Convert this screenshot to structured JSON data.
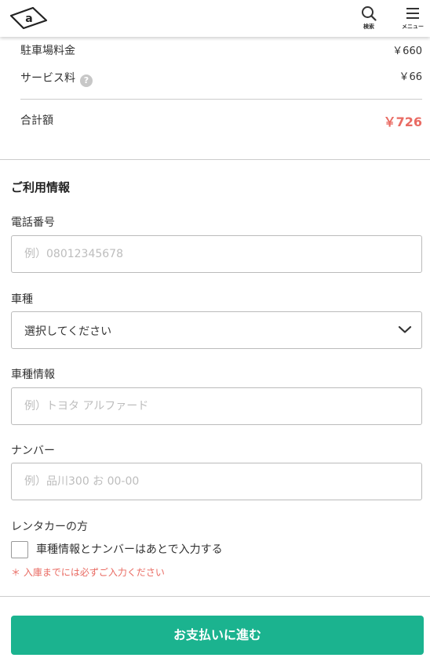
{
  "header": {
    "search_label": "検索",
    "menu_label": "メニュー",
    "logo_letter": "a"
  },
  "fees": {
    "parking": {
      "label": "駐車場料金",
      "amount": "￥660"
    },
    "service": {
      "label": "サービス料",
      "help_icon": "?",
      "amount": "￥66"
    },
    "total": {
      "label": "合計額",
      "amount": "￥726"
    }
  },
  "usage": {
    "title": "ご利用情報",
    "phone": {
      "label": "電話番号",
      "placeholder": "例）08012345678"
    },
    "car_type": {
      "label": "車種",
      "selected": "選択してください"
    },
    "car_info": {
      "label": "車種情報",
      "placeholder": "例）トヨタ アルファード"
    },
    "number": {
      "label": "ナンバー",
      "placeholder": "例）品川300 お 00-00"
    },
    "rental": {
      "label": "レンタカーの方",
      "checkbox_label": "車種情報とナンバーはあとで入力する",
      "note": "＊ 入庫までには必ずご入力ください"
    }
  },
  "pay_button": "お支払いに進む",
  "colors": {
    "accent": "#1bb38f",
    "total": "#e96b63",
    "note": "#e96b63"
  },
  "icons": [
    "logo-icon",
    "search-icon",
    "menu-icon",
    "help-icon",
    "chevron-down-icon"
  ]
}
